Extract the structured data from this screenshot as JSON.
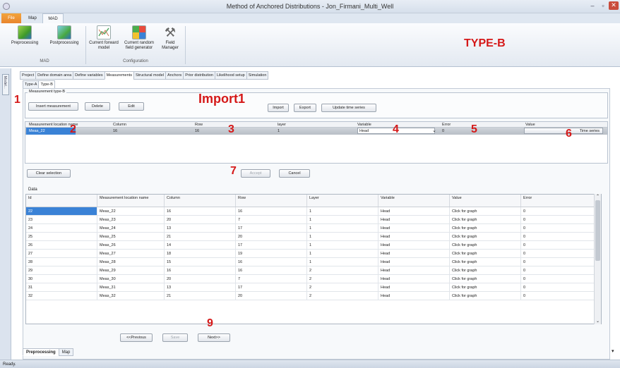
{
  "window": {
    "title": "Method of Anchored Distributions - Jon_Firmani_Multi_Well",
    "min": "–",
    "max": "▫",
    "close": "✕"
  },
  "ribbon_tabs": [
    "File",
    "Map",
    "MAD"
  ],
  "ribbon": {
    "groups": [
      {
        "label": "MAD",
        "buttons": [
          "Preprocessing",
          "Postprocessing"
        ]
      },
      {
        "label": "Configuration",
        "buttons": [
          "Current forward model",
          "Current random field generator",
          "Field Manager"
        ]
      }
    ]
  },
  "left_bar_label": "Model...",
  "main_tabs": [
    "Project",
    "Define domain area",
    "Define variables",
    "Measurements",
    "Structural model",
    "Anchors",
    "Prior distribution",
    "Likelihood setup",
    "Simulation"
  ],
  "sub_tabs": [
    "Type-A",
    "Type-B"
  ],
  "fieldset_label": "Measurement type-B",
  "buttons": {
    "insert": "Insert measurement",
    "delete": "Delete",
    "edit": "Edit",
    "import": "Import",
    "export": "Export",
    "update": "Update time series",
    "clear": "Clear selection",
    "accept": "Accept",
    "cancel": "Cancel",
    "previous": "<<Previous",
    "save": "Save",
    "next": "Next>>"
  },
  "edit_table": {
    "headers": [
      "Measurement location name",
      "Column",
      "Row",
      "layer",
      "Variable",
      "Error",
      "Value"
    ],
    "row": {
      "name": "Meas_22",
      "column": "16",
      "row": "16",
      "layer": "1",
      "variable": "Head",
      "error": "0",
      "value": "Time series"
    }
  },
  "data_label": "Data",
  "data_table": {
    "headers": [
      "Id",
      "Measurement location name",
      "Column",
      "Row",
      "Layer",
      "Variable",
      "Value",
      "Error"
    ],
    "rows": [
      [
        "22",
        "Meas_22",
        "16",
        "16",
        "1",
        "Head",
        "Click for graph",
        "0"
      ],
      [
        "23",
        "Meas_23",
        "20",
        "7",
        "1",
        "Head",
        "Click for graph",
        "0"
      ],
      [
        "24",
        "Meas_24",
        "13",
        "17",
        "1",
        "Head",
        "Click for graph",
        "0"
      ],
      [
        "25",
        "Meas_25",
        "21",
        "20",
        "1",
        "Head",
        "Click for graph",
        "0"
      ],
      [
        "26",
        "Meas_26",
        "14",
        "17",
        "1",
        "Head",
        "Click for graph",
        "0"
      ],
      [
        "27",
        "Meas_27",
        "18",
        "19",
        "1",
        "Head",
        "Click for graph",
        "0"
      ],
      [
        "28",
        "Meas_28",
        "15",
        "16",
        "1",
        "Head",
        "Click for graph",
        "0"
      ],
      [
        "29",
        "Meas_29",
        "16",
        "16",
        "2",
        "Head",
        "Click for graph",
        "0"
      ],
      [
        "30",
        "Meas_30",
        "20",
        "7",
        "2",
        "Head",
        "Click for graph",
        "0"
      ],
      [
        "31",
        "Meas_31",
        "13",
        "17",
        "2",
        "Head",
        "Click for graph",
        "0"
      ],
      [
        "32",
        "Meas_32",
        "21",
        "20",
        "2",
        "Head",
        "Click for graph",
        "0"
      ]
    ]
  },
  "bottom_tabs": [
    "Preprocessing",
    "Map"
  ],
  "status": "Ready.",
  "annotations": {
    "type_b": "TYPE-B",
    "import1": "Import1",
    "n1": "1",
    "n2": "2",
    "n3": "3",
    "n4": "4",
    "n5": "5",
    "n6": "6",
    "n7": "7",
    "n9": "9"
  },
  "colors": {
    "annotation": "#d51818",
    "file_tab": "#e8822c",
    "selection": "#3a82d6"
  }
}
